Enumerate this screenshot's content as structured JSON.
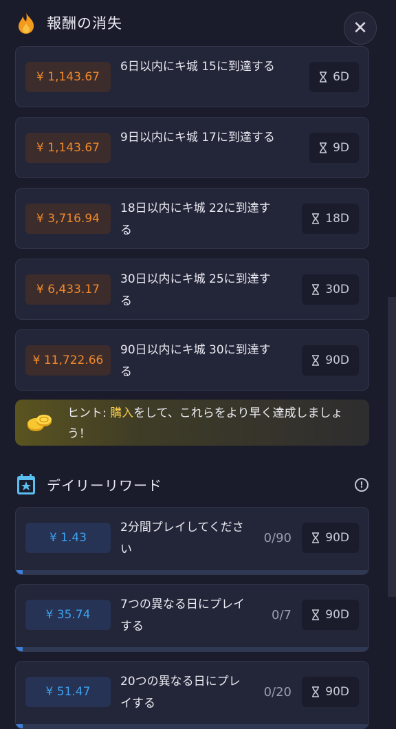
{
  "header": {
    "title": "報酬の消失",
    "close_icon": "✕"
  },
  "expiring": [
    {
      "reward": "¥ 1,143.67",
      "desc": "6日以内にキ城 15に到達する",
      "days": "6D"
    },
    {
      "reward": "¥ 1,143.67",
      "desc": "9日以内にキ城 17に到達する",
      "days": "9D"
    },
    {
      "reward": "¥ 3,716.94",
      "desc": "18日以内にキ城 22に到達する",
      "days": "18D"
    },
    {
      "reward": "¥ 6,433.17",
      "desc": "30日以内にキ城 25に到達する",
      "days": "30D"
    },
    {
      "reward": "¥ 11,722.66",
      "desc": "90日以内にキ城 30に到達する",
      "days": "90D"
    }
  ],
  "hint": {
    "prefix": "ヒント: ",
    "highlight": "購入",
    "suffix": "をして、これらをより早く達成しましょう！",
    "accent": "#f2c94c"
  },
  "daily": {
    "title": "デイリーリワード",
    "items": [
      {
        "reward": "¥ 1.43",
        "desc": "2分間プレイしてください",
        "progress": "0/90",
        "days": "90D",
        "fill": 0.02
      },
      {
        "reward": "¥ 35.74",
        "desc": "7つの異なる日にプレイする",
        "progress": "0/7",
        "days": "90D",
        "fill": 0.02
      },
      {
        "reward": "¥ 51.47",
        "desc": "20つの異なる日にプレイする",
        "progress": "0/20",
        "days": "90D",
        "fill": 0.02
      }
    ]
  }
}
